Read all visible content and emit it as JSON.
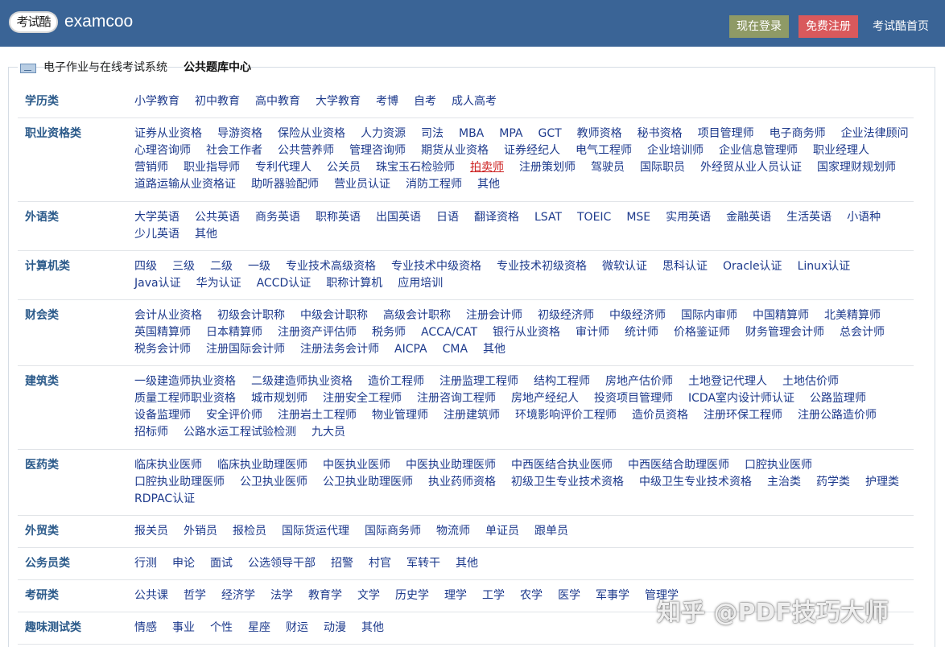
{
  "header": {
    "logo_seal_text": "考试酷",
    "logo_word": "examcoo",
    "login_label": "现在登录",
    "register_label": "免费注册",
    "home_label": "考试酷首页"
  },
  "breadcrumb": {
    "system": "电子作业与在线考试系统",
    "current": "公共题库中心"
  },
  "categories": [
    {
      "name": "学历类",
      "items": [
        "小学教育",
        "初中教育",
        "高中教育",
        "大学教育",
        "考博",
        "自考",
        "成人高考"
      ]
    },
    {
      "name": "职业资格类",
      "items": [
        "证券从业资格",
        "导游资格",
        "保险从业资格",
        "人力资源",
        "司法",
        "MBA",
        "MPA",
        "GCT",
        "教师资格",
        "秘书资格",
        "项目管理师",
        "电子商务师",
        "企业法律顾问",
        "心理咨询师",
        "社会工作者",
        "公共营养师",
        "管理咨询师",
        "期货从业资格",
        "证券经纪人",
        "电气工程师",
        "企业培训师",
        "企业信息管理师",
        "职业经理人",
        "营销师",
        "职业指导师",
        "专利代理人",
        "公关员",
        "珠宝玉石检验师",
        "拍卖师",
        "注册策划师",
        "驾驶员",
        "国际职员",
        "外经贸从业人员认证",
        "国家理财规划师",
        "道路运输从业资格证",
        "助听器验配师",
        "营业员认证",
        "消防工程师",
        "其他"
      ]
    },
    {
      "name": "外语类",
      "items": [
        "大学英语",
        "公共英语",
        "商务英语",
        "职称英语",
        "出国英语",
        "日语",
        "翻译资格",
        "LSAT",
        "TOEIC",
        "MSE",
        "实用英语",
        "金融英语",
        "生活英语",
        "小语种",
        "少儿英语",
        "其他"
      ]
    },
    {
      "name": "计算机类",
      "items": [
        "四级",
        "三级",
        "二级",
        "一级",
        "专业技术高级资格",
        "专业技术中级资格",
        "专业技术初级资格",
        "微软认证",
        "思科认证",
        "Oracle认证",
        "Linux认证",
        "Java认证",
        "华为认证",
        "ACCD认证",
        "职称计算机",
        "应用培训"
      ]
    },
    {
      "name": "财会类",
      "items": [
        "会计从业资格",
        "初级会计职称",
        "中级会计职称",
        "高级会计职称",
        "注册会计师",
        "初级经济师",
        "中级经济师",
        "国际内审师",
        "中国精算师",
        "北美精算师",
        "英国精算师",
        "日本精算师",
        "注册资产评估师",
        "税务师",
        "ACCA/CAT",
        "银行从业资格",
        "审计师",
        "统计师",
        "价格鉴证师",
        "财务管理会计师",
        "总会计师",
        "税务会计师",
        "注册国际会计师",
        "注册法务会计师",
        "AICPA",
        "CMA",
        "其他"
      ]
    },
    {
      "name": "建筑类",
      "items": [
        "一级建造师执业资格",
        "二级建造师执业资格",
        "造价工程师",
        "注册监理工程师",
        "结构工程师",
        "房地产估价师",
        "土地登记代理人",
        "土地估价师",
        "质量工程师职业资格",
        "城市规划师",
        "注册安全工程师",
        "注册咨询工程师",
        "房地产经纪人",
        "投资项目管理师",
        "ICDA室内设计师认证",
        "公路监理师",
        "设备监理师",
        "安全评价师",
        "注册岩土工程师",
        "物业管理师",
        "注册建筑师",
        "环境影响评价工程师",
        "造价员资格",
        "注册环保工程师",
        "注册公路造价师",
        "招标师",
        "公路水运工程试验检测",
        "九大员"
      ]
    },
    {
      "name": "医药类",
      "items": [
        "临床执业医师",
        "临床执业助理医师",
        "中医执业医师",
        "中医执业助理医师",
        "中西医结合执业医师",
        "中西医结合助理医师",
        "口腔执业医师",
        "口腔执业助理医师",
        "公卫执业医师",
        "公卫执业助理医师",
        "执业药师资格",
        "初级卫生专业技术资格",
        "中级卫生专业技术资格",
        "主治类",
        "药学类",
        "护理类",
        "RDPAC认证"
      ]
    },
    {
      "name": "外贸类",
      "items": [
        "报关员",
        "外销员",
        "报检员",
        "国际货运代理",
        "国际商务师",
        "物流师",
        "单证员",
        "跟单员"
      ]
    },
    {
      "name": "公务员类",
      "items": [
        "行测",
        "申论",
        "面试",
        "公选领导干部",
        "招警",
        "村官",
        "军转干",
        "其他"
      ]
    },
    {
      "name": "考研类",
      "items": [
        "公共课",
        "哲学",
        "经济学",
        "法学",
        "教育学",
        "文学",
        "历史学",
        "理学",
        "工学",
        "农学",
        "医学",
        "军事学",
        "管理学"
      ]
    },
    {
      "name": "趣味测试类",
      "items": [
        "情感",
        "事业",
        "个性",
        "星座",
        "财运",
        "动漫",
        "其他"
      ]
    }
  ],
  "highlight_item": "拍卖师",
  "watermark": "知乎 @PDF技巧大师",
  "colors": {
    "topbar": "#3a6496",
    "login_button": "#8f9a66",
    "register_button": "#d9595c",
    "category_label": "#2b5a8a",
    "item_link": "#1d3a8c",
    "highlight_link": "#cc2020"
  }
}
